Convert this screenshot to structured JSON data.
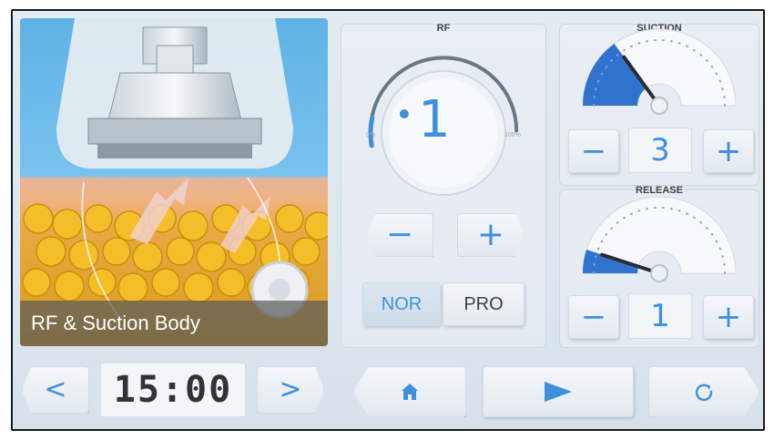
{
  "photo": {
    "caption": "RF & Suction Body"
  },
  "rf": {
    "title": "RF",
    "value": "1",
    "level_percent": 1,
    "scale_min": "0%",
    "scale_max": "100%",
    "minus_label": "−",
    "plus_label": "+",
    "modes": [
      "NOR",
      "PRO"
    ],
    "selected_mode": "NOR"
  },
  "suction": {
    "title": "SUCTION",
    "value": "3",
    "level_fraction": 0.3,
    "minus_label": "−",
    "plus_label": "+"
  },
  "release": {
    "title": "RELEASE",
    "value": "1",
    "level_fraction": 0.1,
    "minus_label": "−",
    "plus_label": "+"
  },
  "timer": {
    "value": "15:00",
    "prev_label": "<",
    "next_label": ">"
  },
  "bottom_bar": {
    "home_icon": "home-icon",
    "play_icon": "play-icon",
    "reset_icon": "reset-icon"
  },
  "colors": {
    "accent": "#3f8fde",
    "gauge_fill": "#2f73cf",
    "needle": "#2b2b2b"
  }
}
